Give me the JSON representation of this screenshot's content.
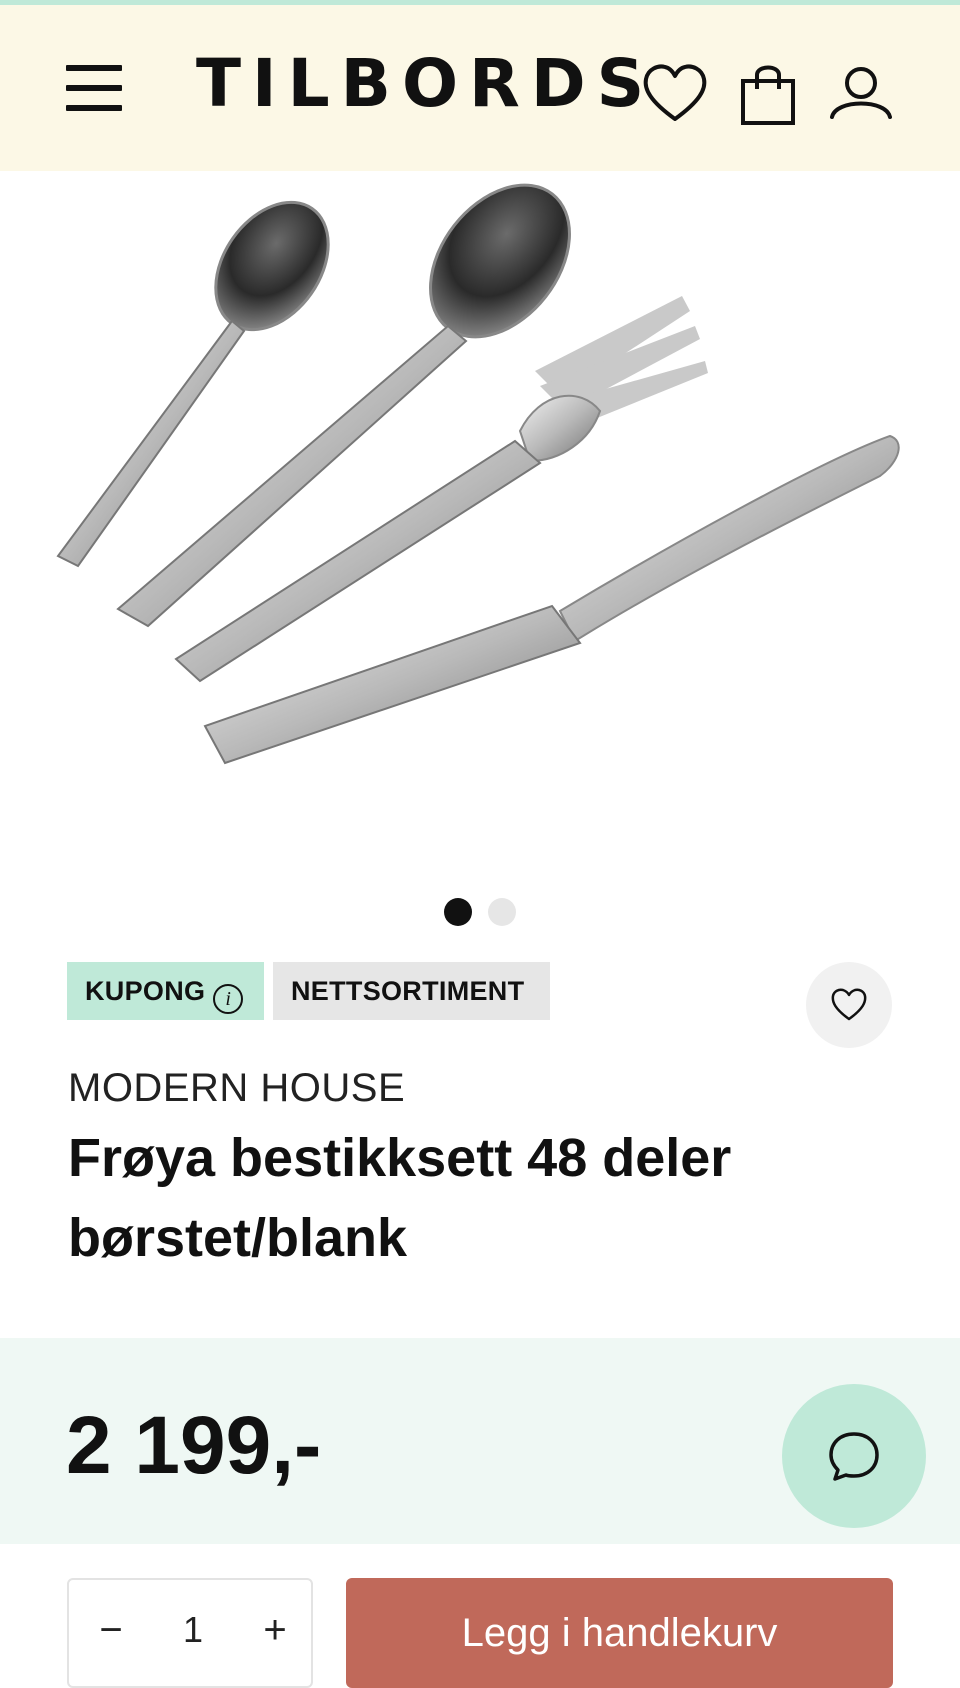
{
  "header": {
    "logo": "TILBORDS",
    "menu_icon": "hamburger-menu-icon",
    "wishlist_icon": "heart-icon",
    "cart_icon": "shopping-bag-icon",
    "account_icon": "user-icon"
  },
  "gallery": {
    "image": "cutlery-set-product-image",
    "slides_total": 2,
    "active_slide": 1
  },
  "badges": {
    "coupon": "KUPONG",
    "coupon_info_glyph": "i",
    "net": "NETTSORTIMENT"
  },
  "product": {
    "brand": "MODERN HOUSE",
    "title": "Frøya bestikksett 48 deler børstet/blank",
    "price": "2 199,-"
  },
  "purchase": {
    "qty_minus": "−",
    "qty_value": "1",
    "qty_plus": "+",
    "add_to_cart": "Legg i handlekurv"
  },
  "colors": {
    "header_bg": "#fcf8e6",
    "mint": "#bfe9d8",
    "price_band": "#eff8f4",
    "cta": "#c0695a"
  }
}
